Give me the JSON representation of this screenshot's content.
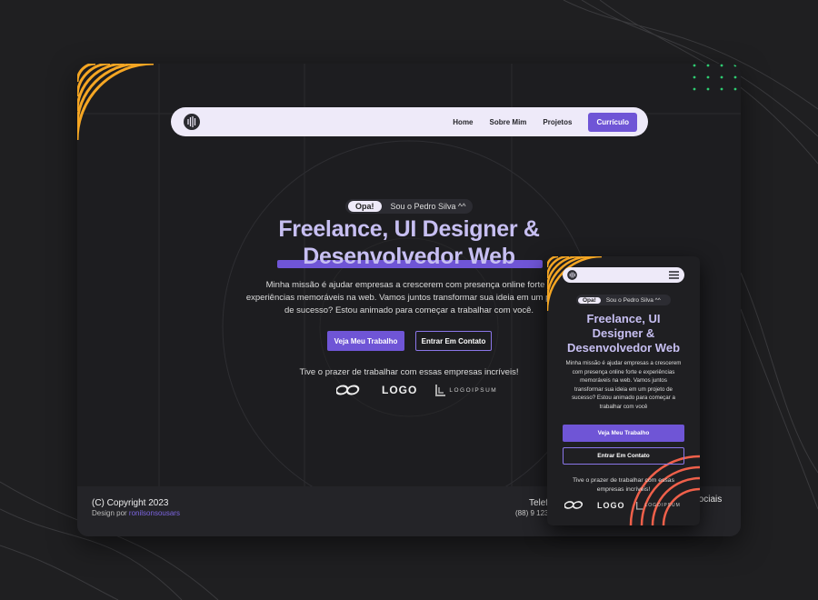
{
  "colors": {
    "accent": "#6f55d6",
    "headline": "#c7bff2",
    "background": "#1f1f21",
    "stripes_orange": "#f5a623",
    "stripes_red": "#f0604a",
    "dots_green": "#2ecc71"
  },
  "desktop": {
    "nav": {
      "logo_icon": "logo-icon",
      "links": [
        "Home",
        "Sobre Mim",
        "Projetos"
      ],
      "cta": "Currículo"
    },
    "hero": {
      "badge": "Opa!",
      "intro": "Sou o Pedro Silva ^^",
      "title_line1": "Freelance, UI Designer &",
      "title_line2": "Desenvolvedor Web",
      "description": "Minha missão é ajudar empresas a crescerem com presença online forte e experiências memoráveis na web. Vamos juntos transformar sua ideia em um projeto de sucesso? Estou animado para começar a trabalhar com você.",
      "primary_button": "Veja Meu Trabalho",
      "secondary_button": "Entrar Em Contato",
      "clients_heading": "Tive o prazer de trabalhar com essas empresas incríveis!",
      "client_logos": [
        "infinity-logo",
        "LOGO",
        "LOGOIPSUM"
      ]
    },
    "footer": {
      "copyright": "(C) Copyright 2023",
      "design_prefix": "Design por",
      "designer": "ronilsonsousars",
      "phone_label": "Telef",
      "phone": "(88) 9 123",
      "socials_label": "Sociais"
    }
  },
  "mobile": {
    "nav": {
      "logo_icon": "logo-icon",
      "menu_icon": "hamburger-icon"
    },
    "hero": {
      "badge": "Opa!",
      "intro": "Sou o Pedro Silva ^^",
      "title_lines": [
        "Freelance, UI",
        "Designer &",
        "Desenvolvedor Web"
      ],
      "description": "Minha missão é ajudar empresas a crescerem com presença online forte e experiências memoráveis na web. Vamos juntos transformar sua ideia em um projeto de sucesso? Estou animado para começar a trabalhar com você",
      "primary_button": "Veja Meu Trabalho",
      "secondary_button": "Entrar Em Contato",
      "clients_heading": "Tive o prazer de trabalhar com essas empresas incríveis!"
    }
  }
}
